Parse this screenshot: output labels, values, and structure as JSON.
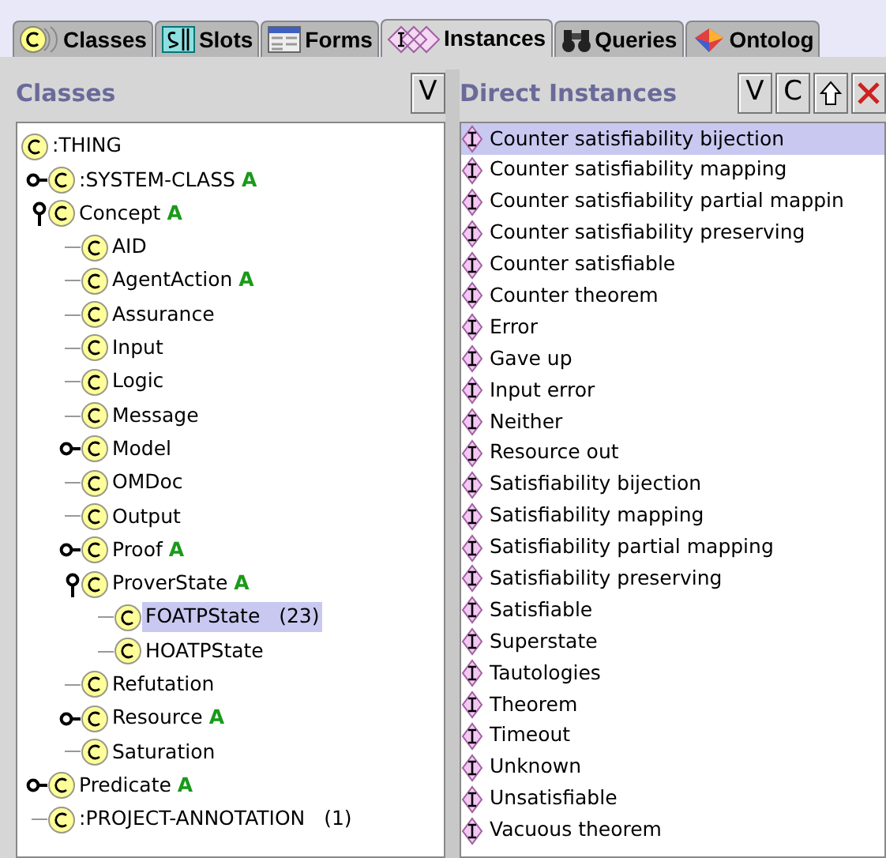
{
  "tabs": [
    {
      "label": "Classes",
      "selected": false
    },
    {
      "label": "Slots",
      "selected": false
    },
    {
      "label": "Forms",
      "selected": false
    },
    {
      "label": "Instances",
      "selected": true
    },
    {
      "label": "Queries",
      "selected": false
    },
    {
      "label": "Ontolog",
      "selected": false
    }
  ],
  "classes_panel": {
    "title": "Classes",
    "buttons": [
      {
        "kind": "text",
        "label": "V"
      }
    ],
    "tree": [
      {
        "label": ":THING",
        "children": [
          {
            "label": ":SYSTEM-CLASS",
            "badge": "A",
            "expanded": false
          },
          {
            "label": "Concept",
            "badge": "A",
            "expanded": true,
            "children": [
              {
                "label": "AID"
              },
              {
                "label": "AgentAction",
                "badge": "A"
              },
              {
                "label": "Assurance"
              },
              {
                "label": "Input"
              },
              {
                "label": "Logic"
              },
              {
                "label": "Message"
              },
              {
                "label": "Model",
                "expanded": false
              },
              {
                "label": "OMDoc"
              },
              {
                "label": "Output"
              },
              {
                "label": "Proof",
                "badge": "A",
                "expanded": false
              },
              {
                "label": "ProverState",
                "badge": "A",
                "expanded": true,
                "children": [
                  {
                    "label": "FOATPState",
                    "count": "(23)",
                    "selected": true
                  },
                  {
                    "label": "HOATPState"
                  }
                ]
              },
              {
                "label": "Refutation"
              },
              {
                "label": "Resource",
                "badge": "A",
                "expanded": false
              },
              {
                "label": "Saturation"
              }
            ]
          },
          {
            "label": "Predicate",
            "badge": "A",
            "expanded": false
          },
          {
            "label": ":PROJECT-ANNOTATION",
            "count": "(1)"
          }
        ]
      }
    ]
  },
  "instances_panel": {
    "title": "Direct Instances",
    "buttons": [
      {
        "kind": "text",
        "label": "V"
      },
      {
        "kind": "text",
        "label": "C"
      },
      {
        "kind": "up"
      },
      {
        "kind": "delete"
      }
    ],
    "items": [
      {
        "label": "Counter satisfiability bijection",
        "selected": true
      },
      {
        "label": "Counter satisfiability mapping",
        "selected": false
      },
      {
        "label": "Counter satisfiability partial mappin",
        "selected": false
      },
      {
        "label": "Counter satisfiability preserving",
        "selected": false
      },
      {
        "label": "Counter satisfiable",
        "selected": false
      },
      {
        "label": "Counter theorem",
        "selected": false
      },
      {
        "label": "Error",
        "selected": false
      },
      {
        "label": "Gave up",
        "selected": false
      },
      {
        "label": "Input error",
        "selected": false
      },
      {
        "label": "Neither",
        "selected": false
      },
      {
        "label": "Resource out",
        "selected": false
      },
      {
        "label": "Satisfiability bijection",
        "selected": false
      },
      {
        "label": "Satisfiability mapping",
        "selected": false
      },
      {
        "label": "Satisfiability partial mapping",
        "selected": false
      },
      {
        "label": "Satisfiability preserving",
        "selected": false
      },
      {
        "label": "Satisfiable",
        "selected": false
      },
      {
        "label": "Superstate",
        "selected": false
      },
      {
        "label": "Tautologies",
        "selected": false
      },
      {
        "label": "Theorem",
        "selected": false
      },
      {
        "label": "Timeout",
        "selected": false
      },
      {
        "label": "Unknown",
        "selected": false
      },
      {
        "label": "Unsatisfiable",
        "selected": false
      },
      {
        "label": "Vacuous theorem",
        "selected": false
      }
    ]
  }
}
